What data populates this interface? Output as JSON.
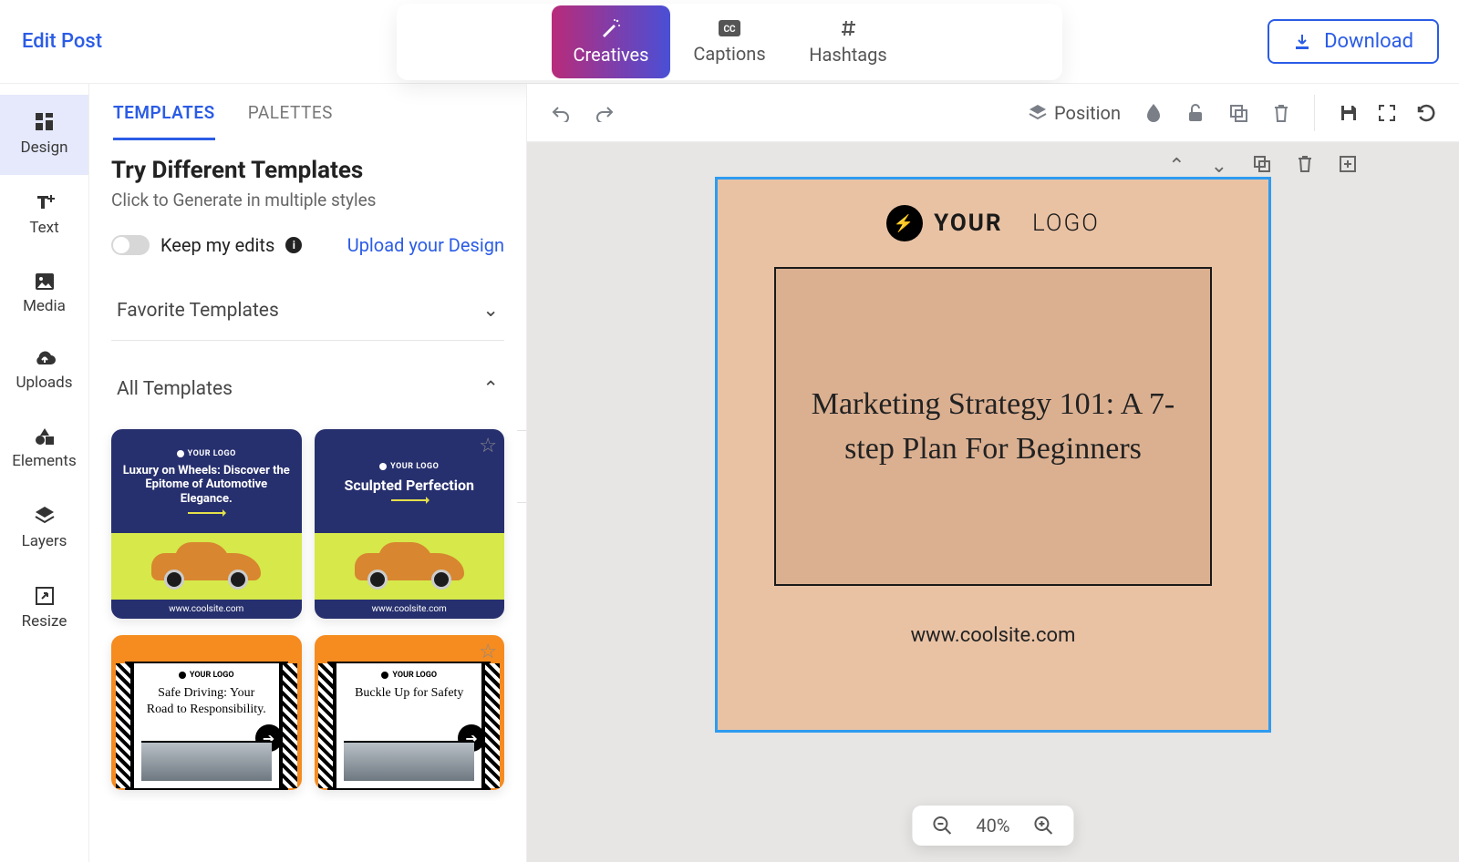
{
  "header": {
    "title": "Edit Post",
    "tabs": [
      {
        "label": "Creatives",
        "icon": "wand-icon"
      },
      {
        "label": "Captions",
        "icon": "cc-icon"
      },
      {
        "label": "Hashtags",
        "icon": "hash-icon"
      }
    ],
    "download": "Download"
  },
  "rail": [
    {
      "label": "Design",
      "icon": "grid-icon"
    },
    {
      "label": "Text",
      "icon": "text-add-icon"
    },
    {
      "label": "Media",
      "icon": "image-icon"
    },
    {
      "label": "Uploads",
      "icon": "cloud-upload-icon"
    },
    {
      "label": "Elements",
      "icon": "shapes-icon"
    },
    {
      "label": "Layers",
      "icon": "layers-icon"
    },
    {
      "label": "Resize",
      "icon": "resize-icon"
    }
  ],
  "panel": {
    "tabs": [
      "TEMPLATES",
      "PALETTES"
    ],
    "try_title": "Try Different Templates",
    "try_sub": "Click to Generate in multiple styles",
    "keep_label": "Keep my edits",
    "upload_link": "Upload your Design",
    "favorites_label": "Favorite Templates",
    "all_label": "All Templates",
    "templates": [
      {
        "logo": "YOUR LOGO",
        "headline": "Luxury on Wheels: Discover the Epitome of Automotive Elegance.",
        "url": "www.coolsite.com"
      },
      {
        "logo": "YOUR LOGO",
        "headline": "Sculpted Perfection",
        "url": "www.coolsite.com"
      },
      {
        "logo": "YOUR LOGO",
        "headline": "Safe Driving: Your Road to Responsibility."
      },
      {
        "logo": "YOUR LOGO",
        "headline": "Buckle Up for Safety"
      }
    ]
  },
  "canvas_toolbar": {
    "position": "Position"
  },
  "artboard": {
    "logo_bold": "YOUR",
    "logo_thin": "LOGO",
    "title": "Marketing Strategy 101: A 7-step Plan For Beginners",
    "url": "www.coolsite.com"
  },
  "zoom": {
    "value": "40%"
  }
}
